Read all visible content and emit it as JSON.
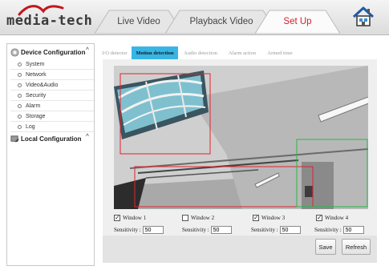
{
  "header": {
    "logo_text": "media-tech",
    "tabs": [
      {
        "label": "Live Video",
        "active": false
      },
      {
        "label": "Playback Video",
        "active": false
      },
      {
        "label": "Set Up",
        "active": true
      }
    ],
    "home_icon": "home-icon"
  },
  "sidebar": {
    "device_config": {
      "label": "Device Configuration",
      "icon": "settings-icon",
      "expanded": true,
      "items": [
        "System",
        "Network",
        "Video&Audio",
        "Security",
        "Alarm",
        "Storage",
        "Log"
      ]
    },
    "local_config": {
      "label": "Local Configuration",
      "icon": "local-config-icon",
      "expanded": true
    }
  },
  "subtabs": [
    {
      "label": "I/O detector",
      "active": false
    },
    {
      "label": "Motion detection",
      "active": true
    },
    {
      "label": "Audio detection",
      "active": false
    },
    {
      "label": "Alarm action",
      "active": false
    },
    {
      "label": "Armed time",
      "active": false
    }
  ],
  "windows": [
    {
      "label": "Window 1",
      "checked": true,
      "sensitivity_label": "Sensitivity :",
      "sensitivity": "50",
      "color": "#e0232f"
    },
    {
      "label": "Window 2",
      "checked": false,
      "sensitivity_label": "Sensitivity :",
      "sensitivity": "50",
      "color": "#e0232f"
    },
    {
      "label": "Window 3",
      "checked": true,
      "sensitivity_label": "Sensitivity :",
      "sensitivity": "50",
      "color": "#e0232f"
    },
    {
      "label": "Window 4",
      "checked": true,
      "sensitivity_label": "Sensitivity :",
      "sensitivity": "50",
      "color": "#27b84a"
    }
  ],
  "buttons": {
    "save": "Save",
    "refresh": "Refresh"
  },
  "colors": {
    "accent_tab": "#37b6e6",
    "setup_tab_text": "#d41e2a"
  }
}
